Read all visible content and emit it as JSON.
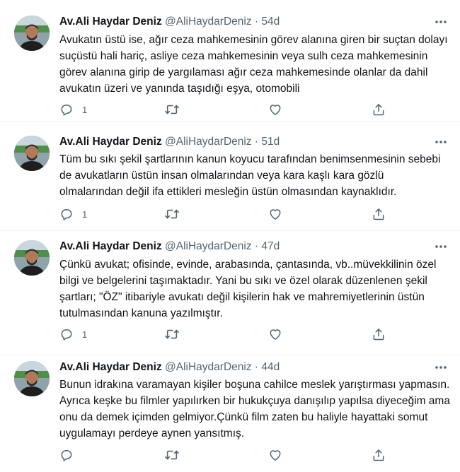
{
  "tweets": [
    {
      "name": "Av.Ali Haydar Deniz",
      "handle": "@AliHaydarDeniz",
      "separator": "·",
      "time": "54d",
      "text": "Avukatın üstü ise, ağır ceza mahkemesinin görev alanına giren bir suçtan dolayı suçüstü hali hariç, asliye ceza mahkemesinin veya sulh ceza mahkemesinin görev alanına girip de yargılaması ağır ceza mahkemesinde olanlar da dahil avukatın üzeri ve yanında taşıdığı eşya, otomobili",
      "reply_count": "1"
    },
    {
      "name": "Av.Ali Haydar Deniz",
      "handle": "@AliHaydarDeniz",
      "separator": "·",
      "time": "51d",
      "text": "Tüm bu sıkı şekil şartlarının kanun koyucu tarafından benimsenmesinin sebebi de avukatların üstün insan olmalarından veya kara kaşlı kara gözlü olmalarından değil ifa ettikleri mesleğin üstün olmasından kaynaklıdır.",
      "reply_count": "1"
    },
    {
      "name": "Av.Ali Haydar Deniz",
      "handle": "@AliHaydarDeniz",
      "separator": "·",
      "time": "47d",
      "text": "Çünkü avukat; ofisinde, evinde, arabasında, çantasında, vb..müvekkilinin özel bilgi ve belgelerini taşımaktadır. Yani bu sıkı ve özel olarak düzenlenen şekil şartları; \"ÖZ\" itibariyle avukatı değil kişilerin hak ve mahremiyetlerinin üstün tutulmasından kanuna yazılmıştır.",
      "reply_count": "1"
    },
    {
      "name": "Av.Ali Haydar Deniz",
      "handle": "@AliHaydarDeniz",
      "separator": "·",
      "time": "44d",
      "text": "Bunun idrakına varamayan kişiler boşuna cahilce meslek yarıştırması yapmasın.  Ayrıca keşke bu filmler yapılırken bir hukukçuya danışılıp yapılsa diyeceğim ama onu da demek içimden gelmiyor.Çünkü film zaten bu haliyle hayattaki somut uygulamayı perdeye aynen yansıtmış.",
      "reply_count": ""
    }
  ],
  "icons": {
    "avatar": "avatar-photo",
    "more": "more-icon",
    "reply": "reply-icon",
    "retweet": "retweet-icon",
    "like": "like-icon",
    "share": "share-icon"
  },
  "colors": {
    "text": "#0f1419",
    "secondary": "#536471",
    "divider": "#eff3f4"
  }
}
